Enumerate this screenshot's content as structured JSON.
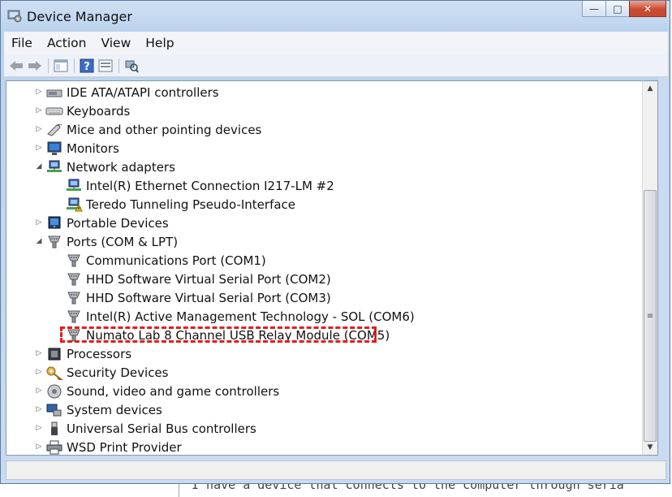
{
  "window": {
    "title": "Device Manager",
    "minimize": "—",
    "maximize": "□",
    "close": "✕"
  },
  "menu": [
    "File",
    "Action",
    "View",
    "Help"
  ],
  "toolbar": [
    "back",
    "forward",
    "properties",
    "help",
    "show-hide",
    "scan-hardware"
  ],
  "tree": [
    {
      "label": "IDE ATA/ATAPI controllers",
      "level": 0,
      "expanded": false,
      "icon": "ide-controller-icon"
    },
    {
      "label": "Keyboards",
      "level": 0,
      "expanded": false,
      "icon": "keyboard-icon"
    },
    {
      "label": "Mice and other pointing devices",
      "level": 0,
      "expanded": false,
      "icon": "mouse-icon"
    },
    {
      "label": "Monitors",
      "level": 0,
      "expanded": false,
      "icon": "monitor-icon"
    },
    {
      "label": "Network adapters",
      "level": 0,
      "expanded": true,
      "icon": "network-adapter-icon"
    },
    {
      "label": "Intel(R) Ethernet Connection I217-LM #2",
      "level": 1,
      "icon": "network-adapter-icon"
    },
    {
      "label": "Teredo Tunneling Pseudo-Interface",
      "level": 1,
      "icon": "network-adapter-warning-icon"
    },
    {
      "label": "Portable Devices",
      "level": 0,
      "expanded": false,
      "icon": "portable-device-icon"
    },
    {
      "label": "Ports (COM & LPT)",
      "level": 0,
      "expanded": true,
      "icon": "port-icon"
    },
    {
      "label": "Communications Port (COM1)",
      "level": 1,
      "icon": "port-icon"
    },
    {
      "label": "HHD Software Virtual Serial Port (COM2)",
      "level": 1,
      "icon": "port-icon"
    },
    {
      "label": "HHD Software Virtual Serial Port (COM3)",
      "level": 1,
      "icon": "port-icon"
    },
    {
      "label": "Intel(R) Active Management Technology - SOL (COM6)",
      "level": 1,
      "icon": "port-icon"
    },
    {
      "label": "Numato Lab 8 Channel USB Relay Module (COM5)",
      "level": 1,
      "icon": "port-icon",
      "highlighted": true
    },
    {
      "label": "Processors",
      "level": 0,
      "expanded": false,
      "icon": "processor-icon"
    },
    {
      "label": "Security Devices",
      "level": 0,
      "expanded": false,
      "icon": "key-icon"
    },
    {
      "label": "Sound, video and game controllers",
      "level": 0,
      "expanded": false,
      "icon": "speaker-icon"
    },
    {
      "label": "System devices",
      "level": 0,
      "expanded": false,
      "icon": "system-device-icon"
    },
    {
      "label": "Universal Serial Bus controllers",
      "level": 0,
      "expanded": false,
      "icon": "usb-icon"
    },
    {
      "label": "WSD Print Provider",
      "level": 0,
      "expanded": false,
      "icon": "printer-icon"
    }
  ],
  "highlight_color": "#e31d1d",
  "background_text": "I have a device that connects to the computer through seria"
}
